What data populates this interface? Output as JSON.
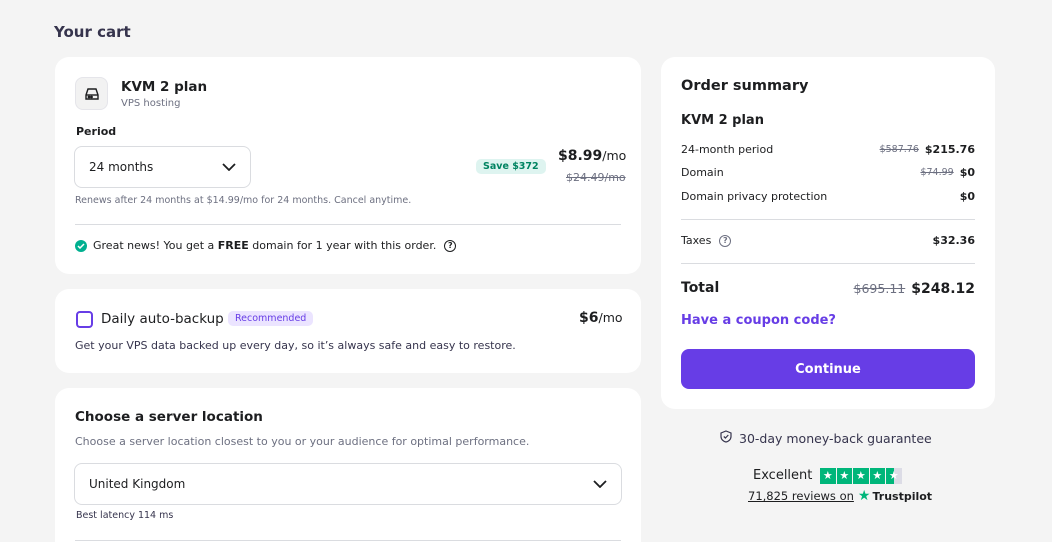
{
  "page": {
    "title": "Your cart"
  },
  "plan": {
    "name": "KVM 2 plan",
    "subtitle": "VPS hosting",
    "period_label": "Period",
    "period_value": "24 months",
    "save_badge": "Save $372",
    "price": "$8.99",
    "price_unit": "/mo",
    "old_price": "$24.49/mo",
    "renew_note": "Renews after 24 months at $14.99/mo for 24 months. Cancel anytime.",
    "free_domain_pre": "Great news! You get a ",
    "free_domain_bold": "FREE",
    "free_domain_post": " domain for 1 year with this order.",
    "help_icon": "?"
  },
  "backup": {
    "title": "Daily auto-backup",
    "badge": "Recommended",
    "price": "$6",
    "price_unit": "/mo",
    "description": "Get your VPS data backed up every day, so it’s always safe and easy to restore.",
    "checked": false
  },
  "location": {
    "title": "Choose a server location",
    "description": "Choose a server location closest to you or your audience for optimal performance.",
    "selected": "United Kingdom",
    "latency": "Best latency 114 ms"
  },
  "summary": {
    "title": "Order summary",
    "plan_name": "KVM 2 plan",
    "rows": [
      {
        "label": "24-month period",
        "old": "$587.76",
        "value": "$215.76"
      },
      {
        "label": "Domain",
        "old": "$74.99",
        "value": "$0"
      },
      {
        "label": "Domain privacy protection",
        "old": "",
        "value": "$0"
      }
    ],
    "taxes_label": "Taxes",
    "taxes_value": "$32.36",
    "total_label": "Total",
    "total_old": "$695.11",
    "total_value": "$248.12",
    "coupon_label": "Have a coupon code?",
    "continue_label": "Continue"
  },
  "guarantee": "30-day money-back guarantee",
  "trustpilot": {
    "rating_label": "Excellent",
    "stars": 4.5,
    "reviews_link": "71,825 reviews on",
    "brand": "Trustpilot"
  },
  "colors": {
    "accent": "#673de6",
    "success": "#00b090",
    "trustpilot": "#00b67a"
  }
}
